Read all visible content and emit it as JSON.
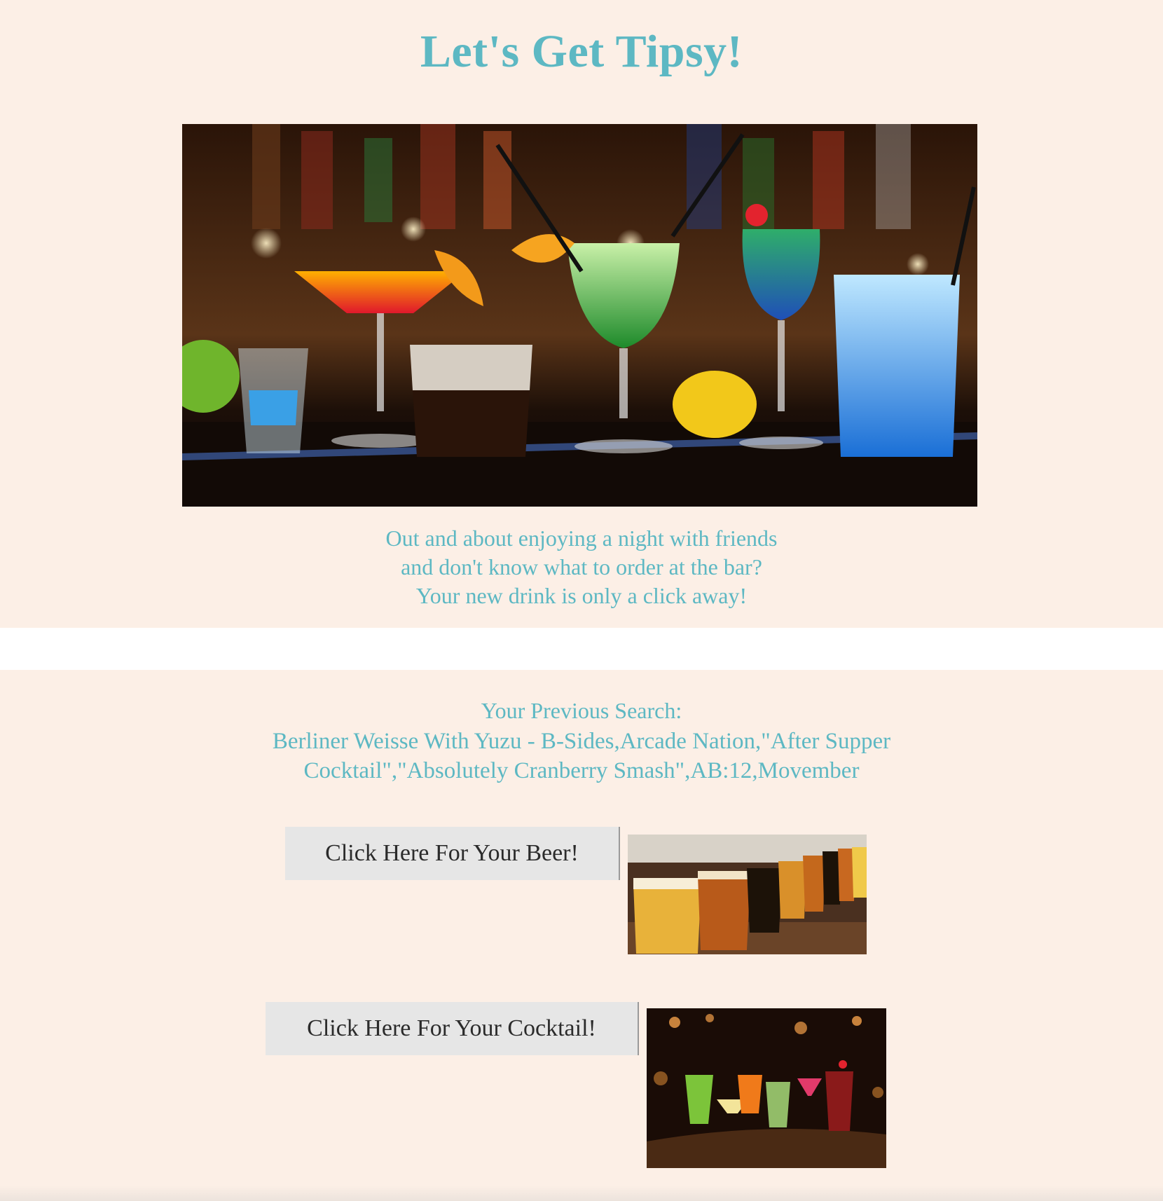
{
  "header": {
    "title": "Let's Get Tipsy!"
  },
  "hero": {
    "image_alt": "Colorful cocktails on a bar counter",
    "intro_lines": [
      "Out and about enjoying a night with friends",
      "and don't know what to order at the bar?",
      "Your new drink is only a click away!"
    ]
  },
  "previous_search": {
    "label": "Your Previous Search:",
    "value": "Berliner Weisse With Yuzu - B-Sides,Arcade Nation,\"After Supper Cocktail\",\"Absolutely Cranberry Smash\",AB:12,Movember"
  },
  "actions": {
    "beer_button_label": "Click Here For Your Beer!",
    "beer_image_alt": "Row of beer glasses",
    "cocktail_button_label": "Click Here For Your Cocktail!",
    "cocktail_image_alt": "Row of cocktails at a bar"
  },
  "colors": {
    "background": "#fcefe6",
    "accent": "#5db8c3",
    "button_bg": "#e6e6e6",
    "button_text": "#2b2b2b",
    "divider_band": "#ffffff"
  }
}
